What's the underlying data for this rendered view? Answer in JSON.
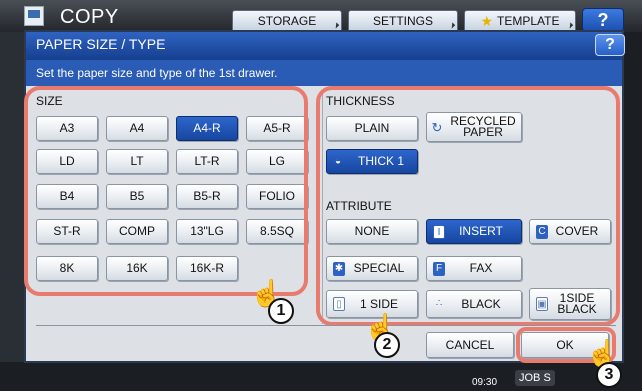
{
  "app": {
    "title": "COPY"
  },
  "topbar": {
    "storage": "STORAGE",
    "settings": "SETTINGS",
    "template": "TEMPLATE",
    "help": "?"
  },
  "dialog": {
    "title": "PAPER SIZE / TYPE",
    "help": "?",
    "instruction": "Set the paper size and type of the 1st drawer."
  },
  "size": {
    "label": "SIZE",
    "rows": [
      [
        "A3",
        "A4",
        "A4-R",
        "A5-R"
      ],
      [
        "LD",
        "LT",
        "LT-R",
        "LG"
      ],
      [
        "B4",
        "B5",
        "B5-R",
        "FOLIO"
      ],
      [
        "ST-R",
        "COMP",
        "13\"LG",
        "8.5SQ"
      ],
      [
        "8K",
        "16K",
        "16K-R"
      ]
    ],
    "selected": "A4-R"
  },
  "thickness": {
    "label": "THICKNESS",
    "plain": "PLAIN",
    "recycled_line1": "RECYCLED",
    "recycled_line2": "PAPER",
    "thick1": "THICK 1",
    "selected": "THICK 1"
  },
  "attribute": {
    "label": "ATTRIBUTE",
    "none": "NONE",
    "insert": "INSERT",
    "cover": "COVER",
    "special": "SPECIAL",
    "fax": "FAX",
    "oneside": "1 SIDE",
    "black": "BLACK",
    "oneside_black_line1": "1SIDE",
    "oneside_black_line2": "BLACK",
    "selected": "INSERT"
  },
  "footer": {
    "cancel": "CANCEL",
    "ok": "OK"
  },
  "status": {
    "clock": "09:30",
    "jobs": "JOB S"
  },
  "steps": [
    "1",
    "2",
    "3"
  ],
  "colors": {
    "highlight": "#e87a6e",
    "selected": "#1f55b5",
    "titlebar": "#1f4ea6"
  }
}
